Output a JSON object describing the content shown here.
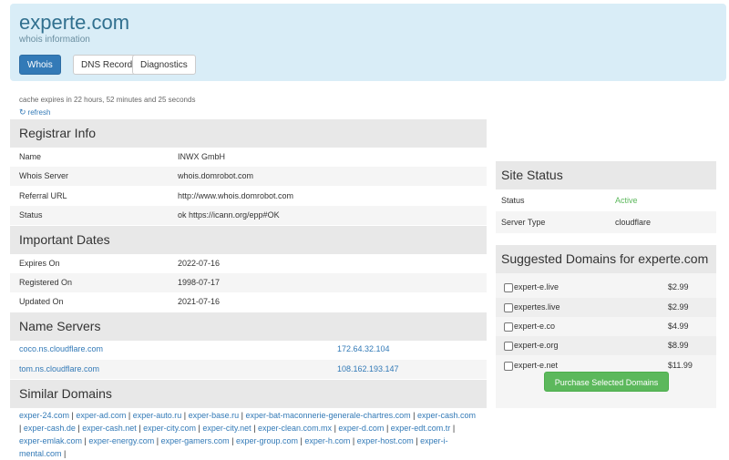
{
  "header": {
    "title": "experte.com",
    "subtitle": "whois information",
    "tabs": [
      {
        "label": "Whois"
      },
      {
        "label": "DNS Records"
      },
      {
        "label": "Diagnostics"
      }
    ]
  },
  "cache": {
    "text": "cache expires in 22 hours, 52 minutes and 25 seconds",
    "refresh_label": "refresh",
    "refresh_icon": "refresh-icon"
  },
  "registrar": {
    "heading": "Registrar Info",
    "rows": [
      {
        "key": "Name",
        "value": "INWX GmbH"
      },
      {
        "key": "Whois Server",
        "value": "whois.domrobot.com"
      },
      {
        "key": "Referral URL",
        "value": "http://www.whois.domrobot.com"
      },
      {
        "key": "Status",
        "value": "ok https://icann.org/epp#OK"
      }
    ]
  },
  "dates": {
    "heading": "Important Dates",
    "rows": [
      {
        "key": "Expires On",
        "value": "2022-07-16"
      },
      {
        "key": "Registered On",
        "value": "1998-07-17"
      },
      {
        "key": "Updated On",
        "value": "2021-07-16"
      }
    ]
  },
  "nameservers": {
    "heading": "Name Servers",
    "rows": [
      {
        "host": "coco.ns.cloudflare.com",
        "ip": "172.64.32.104"
      },
      {
        "host": "tom.ns.cloudflare.com",
        "ip": "108.162.193.147"
      }
    ]
  },
  "similar": {
    "heading": "Similar Domains",
    "domains": [
      "exper-24.com",
      "exper-ad.com",
      "exper-auto.ru",
      "exper-base.ru",
      "exper-bat-maconnerie-generale-chartres.com",
      "exper-cash.com",
      "exper-cash.de",
      "exper-cash.net",
      "exper-city.com",
      "exper-city.net",
      "exper-clean.com.mx",
      "exper-d.com",
      "exper-edt.com.tr",
      "exper-emlak.com",
      "exper-energy.com",
      "exper-gamers.com",
      "exper-group.com",
      "exper-h.com",
      "exper-host.com",
      "exper-i-mental.com"
    ]
  },
  "site_status": {
    "heading": "Site Status",
    "rows": [
      {
        "key": "Status",
        "value": "Active"
      },
      {
        "key": "Server Type",
        "value": "cloudflare"
      }
    ],
    "active_color": "#5cb85c"
  },
  "suggested": {
    "heading": "Suggested Domains for experte.com",
    "items": [
      {
        "name": "expert-e.live",
        "price": "$2.99"
      },
      {
        "name": "expertes.live",
        "price": "$2.99"
      },
      {
        "name": "expert-e.co",
        "price": "$4.99"
      },
      {
        "name": "expert-e.org",
        "price": "$8.99"
      },
      {
        "name": "expert-e.net",
        "price": "$11.99"
      }
    ],
    "button_label": "Purchase Selected Domains"
  },
  "colors": {
    "header_bg": "#d9edf7",
    "accent": "#337ab7",
    "success": "#5cb85c"
  }
}
